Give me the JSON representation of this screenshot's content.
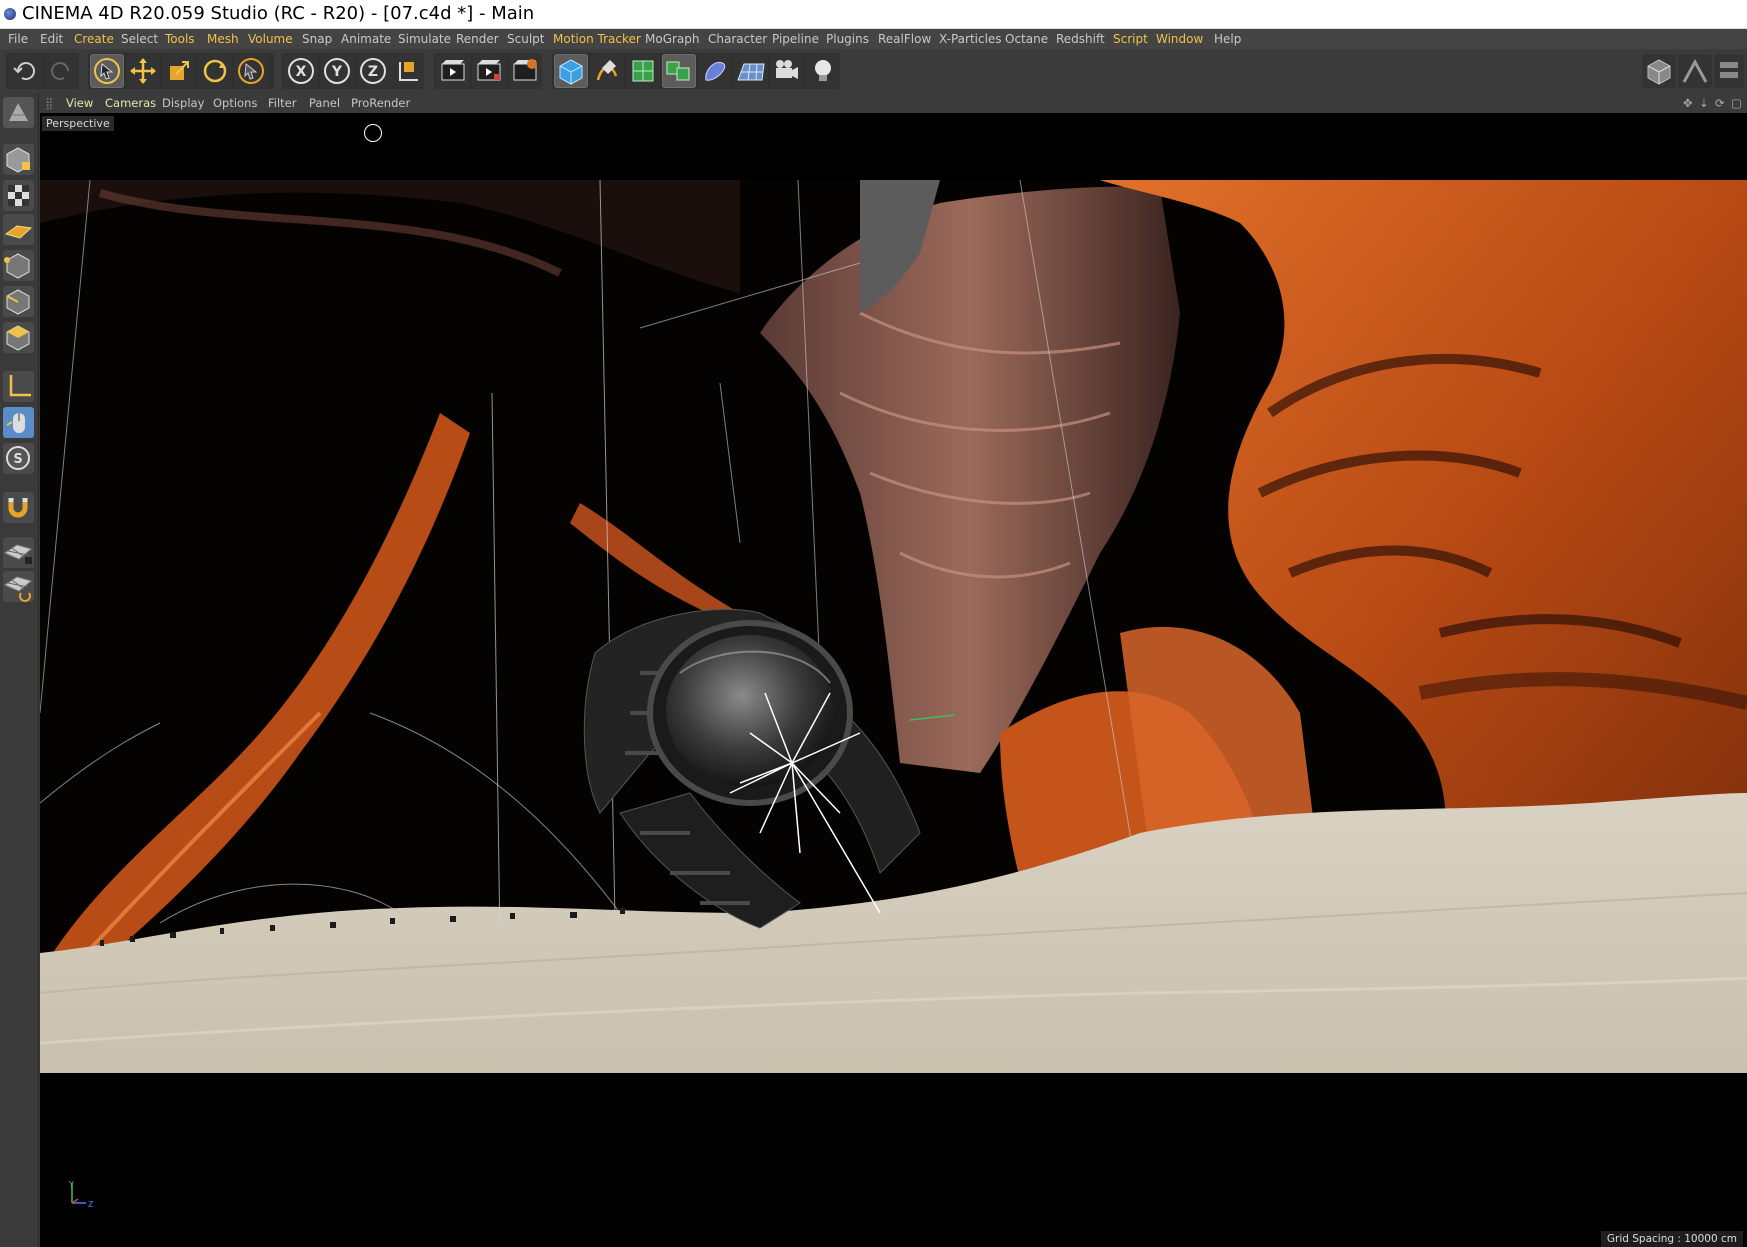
{
  "window": {
    "title": "CINEMA 4D R20.059 Studio (RC - R20) - [07.c4d *] - Main"
  },
  "menu": {
    "items": [
      "File",
      "Edit",
      "Create",
      "Select",
      "Tools",
      "Mesh",
      "Volume",
      "Snap",
      "Animate",
      "Simulate",
      "Render",
      "Sculpt",
      "Motion Tracker",
      "MoGraph",
      "Character",
      "Pipeline",
      "Plugins",
      "RealFlow",
      "X-Particles",
      "Octane",
      "Redshift",
      "Script",
      "Window",
      "Help"
    ]
  },
  "toolbar": {
    "undo": "undo-icon",
    "redo": "redo-icon",
    "axes": [
      "X",
      "Y",
      "Z"
    ]
  },
  "viewport": {
    "menu": [
      "View",
      "Cameras",
      "Display",
      "Options",
      "Filter",
      "Panel",
      "ProRender"
    ],
    "label": "Perspective",
    "grid_spacing": "Grid Spacing : 10000 cm",
    "axis_y": "Y",
    "axis_z": "Z"
  },
  "colors": {
    "accent_yellow": "#f0c24a",
    "rock_orange": "#c4541a",
    "sand": "#d8d0c0",
    "active_blue": "#3aa0e0"
  }
}
